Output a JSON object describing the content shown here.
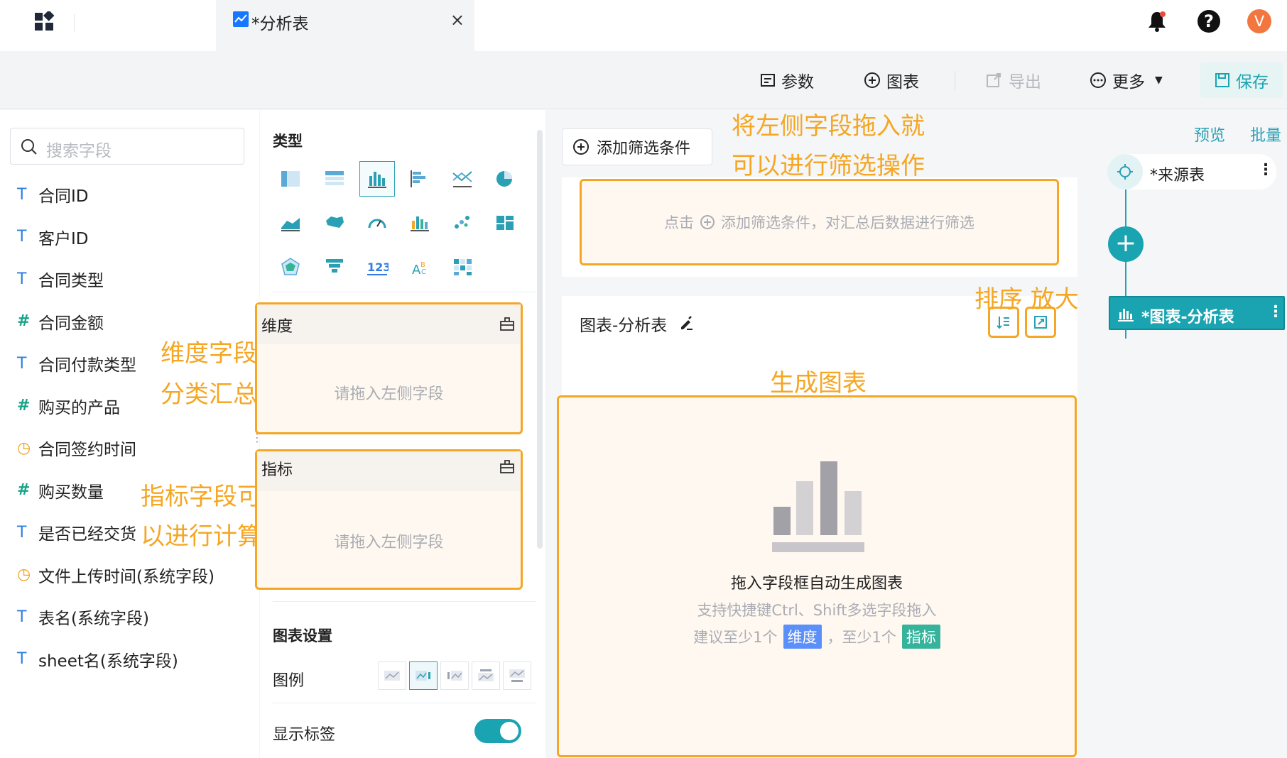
{
  "tab": {
    "title": "*分析表",
    "close": "×"
  },
  "header": {
    "avatar_letter": "V"
  },
  "toolbar": {
    "params": "参数",
    "chart": "图表",
    "export": "导出",
    "more": "更多",
    "save": "保存"
  },
  "fields_panel": {
    "search_placeholder": "搜索字段",
    "fields": [
      {
        "type": "T",
        "name": "合同ID"
      },
      {
        "type": "T",
        "name": "客户ID"
      },
      {
        "type": "T",
        "name": "合同类型"
      },
      {
        "type": "#",
        "name": "合同金额"
      },
      {
        "type": "T",
        "name": "合同付款类型"
      },
      {
        "type": "#",
        "name": "购买的产品"
      },
      {
        "type": "time",
        "name": "合同签约时间"
      },
      {
        "type": "#",
        "name": "购买数量"
      },
      {
        "type": "T",
        "name": "是否已经交货"
      },
      {
        "type": "time",
        "name": "文件上传时间(系统字段)"
      },
      {
        "type": "T",
        "name": "表名(系统字段)"
      },
      {
        "type": "T",
        "name": "sheet名(系统字段)"
      }
    ]
  },
  "annotations": {
    "dim_1": "维度字段",
    "dim_2": "分类汇总",
    "metric_1": "指标字段可",
    "metric_2": "以进行计算",
    "filter_1": "将左侧字段拖入就",
    "filter_2": "可以进行筛选操作",
    "sort_zoom": "排序  放大",
    "generate": "生成图表"
  },
  "type_panel": {
    "type_title": "类型",
    "dimension_label": "维度",
    "metric_label": "指标",
    "drop_placeholder": "请拖入左侧字段",
    "settings_title": "图表设置",
    "legend_label": "图例",
    "show_label": "显示标签"
  },
  "main": {
    "add_filter": "添加筛选条件",
    "filter_hint_prefix": "点击",
    "filter_hint_suffix": "添加筛选条件，对汇总后数据进行筛选",
    "chart_title": "图表-分析表",
    "empty_title": "拖入字段框自动生成图表",
    "empty_sub": "支持快捷键Ctrl、Shift多选字段拖入",
    "empty_hint_a": "建议至少1个",
    "empty_tag_dim": "维度",
    "empty_hint_b": "，至少1个",
    "empty_tag_metric": "指标"
  },
  "right_panel": {
    "preview": "预览",
    "batch": "批量",
    "source_node": "*来源表",
    "chart_node": "*图表-分析表"
  },
  "colors": {
    "accent": "#1aa3b0",
    "annotation": "#f5a623",
    "dim_tag": "#5b8ff9",
    "metric_tag": "#36b39b"
  }
}
